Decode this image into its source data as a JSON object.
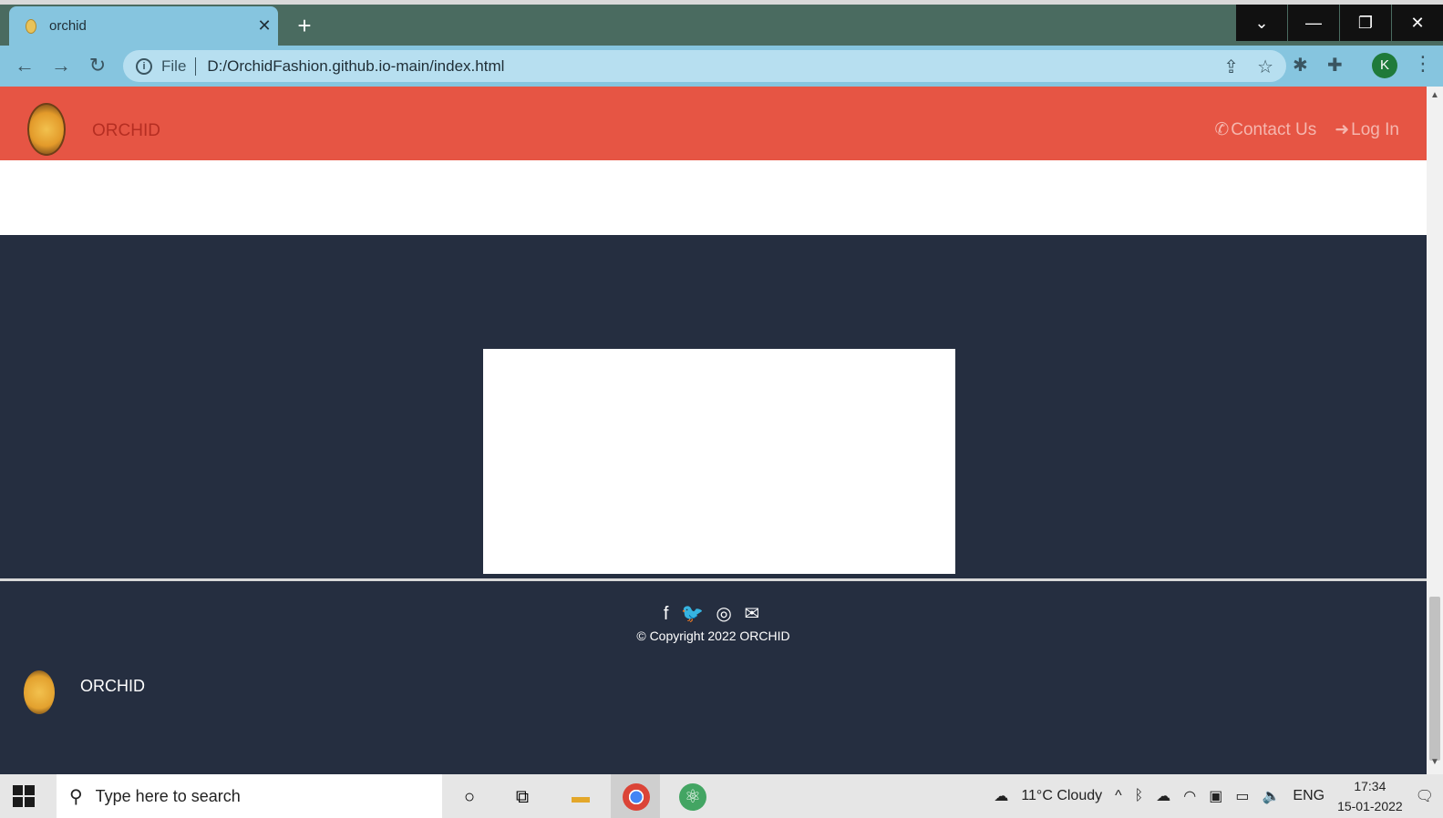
{
  "browser": {
    "tab_title": "orchid",
    "new_tab": "+",
    "window_buttons": [
      "⌄",
      "—",
      "❐",
      "✕"
    ],
    "nav": {
      "back": "←",
      "forward": "→",
      "reload": "↻"
    },
    "scheme": "File",
    "url": "D:/OrchidFashion.github.io-main/index.html",
    "profile_initial": "K"
  },
  "site": {
    "brand": "ORCHID",
    "nav_links": {
      "contact": "Contact Us",
      "login": "Log In"
    },
    "social_icons": [
      "facebook-icon",
      "twitter-icon",
      "instagram-icon",
      "mail-icon"
    ],
    "social_glyphs": "f 🐦 ◎ ✉",
    "copyright": "© Copyright 2022 ORCHID",
    "footer_brand": "ORCHID"
  },
  "taskbar": {
    "search_placeholder": "Type here to search",
    "weather": "11°C  Cloudy",
    "language": "ENG",
    "time": "17:34",
    "date": "15-01-2022"
  },
  "colors": {
    "navbar": "#e65544",
    "dark_section": "#252e40",
    "browser_tab": "#86c5df",
    "titlebar": "#4a6b60"
  }
}
